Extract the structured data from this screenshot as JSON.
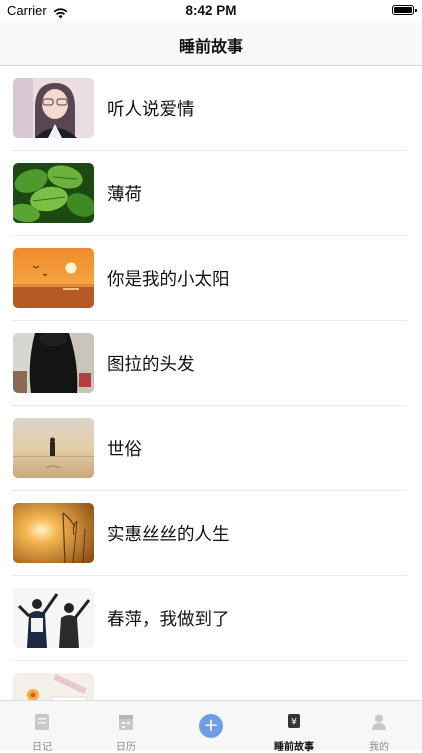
{
  "status_bar": {
    "carrier": "Carrier",
    "time": "8:42 PM"
  },
  "nav": {
    "title": "睡前故事"
  },
  "stories": [
    {
      "title": "听人说爱情",
      "thumb_icon": "girl-with-glasses-photo"
    },
    {
      "title": "薄荷",
      "thumb_icon": "mint-leaves-photo"
    },
    {
      "title": "你是我的小太阳",
      "thumb_icon": "ocean-sunset-photo"
    },
    {
      "title": "图拉的头发",
      "thumb_icon": "long-hair-photo"
    },
    {
      "title": "世俗",
      "thumb_icon": "person-in-sea-photo"
    },
    {
      "title": "实惠丝丝的人生",
      "thumb_icon": "reeds-sunset-photo"
    },
    {
      "title": "春萍，我做到了",
      "thumb_icon": "two-friends-cheering-photo"
    },
    {
      "title": "",
      "thumb_icon": "stationery-photo"
    }
  ],
  "tabs": [
    {
      "label": "日记",
      "icon": "diary-icon",
      "active": false
    },
    {
      "label": "日历",
      "icon": "calendar-icon",
      "active": false
    },
    {
      "label": "",
      "icon": "plus-icon",
      "active": false
    },
    {
      "label": "睡前故事",
      "icon": "bedtime-story-icon",
      "active": true
    },
    {
      "label": "我的",
      "icon": "profile-icon",
      "active": false
    }
  ],
  "colors": {
    "accent": "#6e9fe6",
    "tab_inactive": "#8c8c8c",
    "separator": "#ececec"
  }
}
